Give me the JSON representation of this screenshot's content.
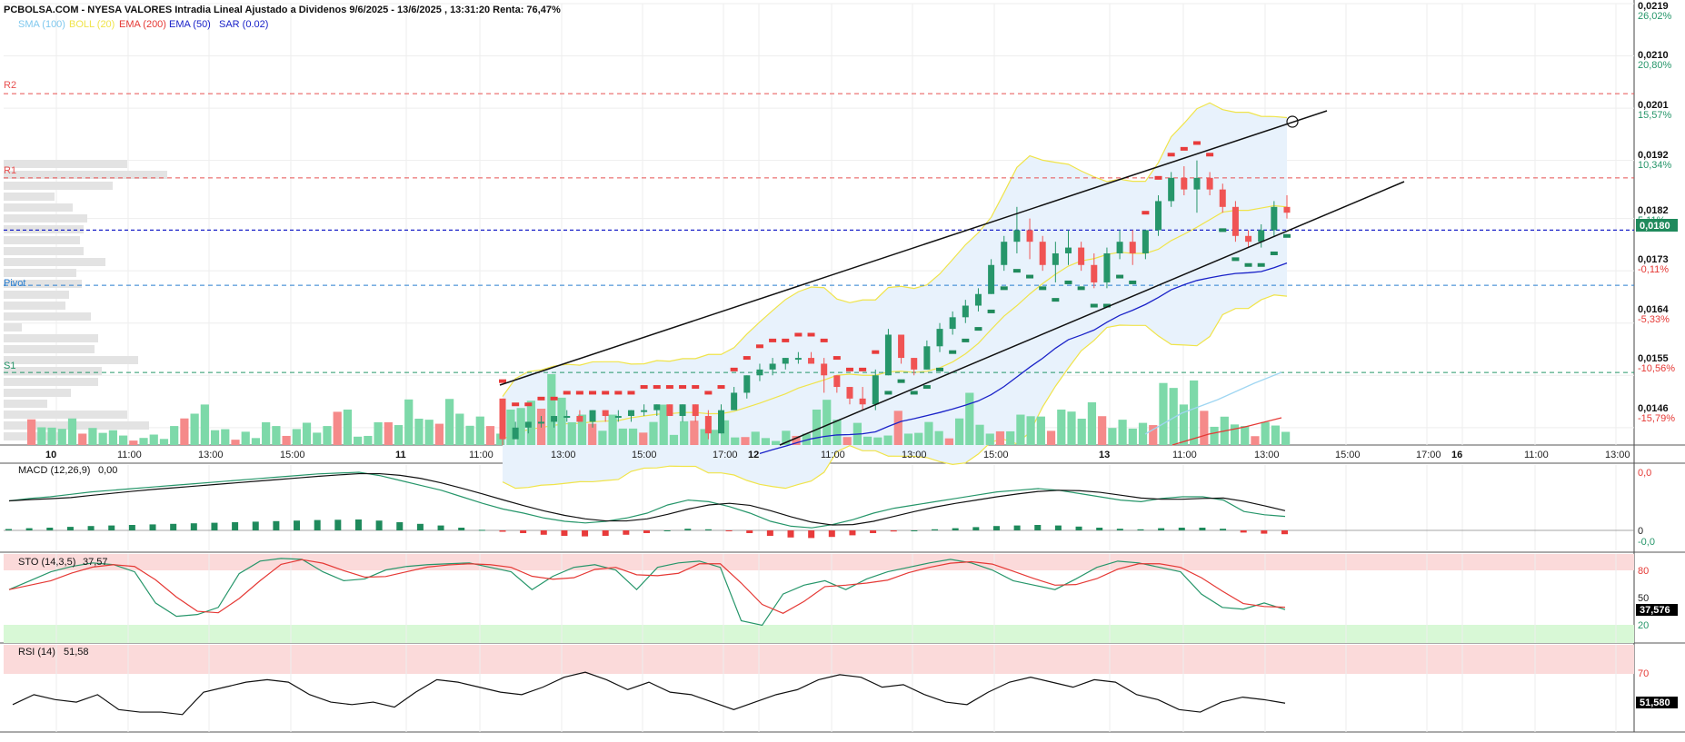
{
  "header": {
    "title": "PCBOLSA.COM - NYESA VALORES Intradia Lineal Ajustado a Dividenos 9/6/2025 - 13/6/2025 , 13:31:20 Renta: 76,47%",
    "indicators": [
      {
        "label": "SMA (100)",
        "color": "#7fc8ee"
      },
      {
        "label": "BOLL (20)",
        "color": "#f0e44a"
      },
      {
        "label": "EMA (200)",
        "color": "#e53935"
      },
      {
        "label": "EMA (50)",
        "color": "#1a22c8"
      },
      {
        "label": "SAR (0.02)",
        "color": "#1a22c8"
      }
    ]
  },
  "colors": {
    "up": "#26966a",
    "down": "#f05454",
    "vol_up": "#7dd9a9",
    "vol_down": "#f58a8a",
    "sar_up": "#1f8a5c",
    "sar_down": "#e83b3b"
  },
  "price_axis": {
    "ticks": [
      "0,0219",
      "0,0210",
      "0,0201",
      "0,0192",
      "0,0182",
      "0,0173",
      "0,0164",
      "0,0155",
      "0,0146"
    ],
    "pcts": [
      "26,02%",
      "20,80%",
      "15,57%",
      "10,34%",
      "5,11%",
      "-0,11%",
      "-5,33%",
      "-10,56%",
      "-15,79%"
    ],
    "current": "0,0180"
  },
  "levels": {
    "R2": "R2",
    "R1": "R1",
    "Pivot": "Pivot",
    "S1": "S1"
  },
  "time_axis": {
    "days": [
      "10",
      "11",
      "12",
      "13",
      "16"
    ],
    "hours": [
      "11:00",
      "13:00",
      "15:00",
      "11:00",
      "13:00",
      "15:00",
      "17:00",
      "11:00",
      "13:00",
      "15:00",
      "11:00",
      "13:00",
      "15:00",
      "17:00",
      "11:00",
      "13:00"
    ]
  },
  "macd": {
    "label": "MACD (12,26,9)",
    "value": "0,00",
    "ticks": [
      "0,0",
      "0",
      "-0,0"
    ]
  },
  "sto": {
    "label": "STO (14,3,5)",
    "value": "37,57",
    "ticks": [
      "80",
      "50",
      "20"
    ],
    "current": "37,576"
  },
  "rsi": {
    "label": "RSI (14)",
    "value": "51,58",
    "ticks": [
      "70"
    ],
    "current": "51,580"
  },
  "chart_data": {
    "type": "candlestick",
    "title": "PCBOLSA.COM - NYESA VALORES Intradia Lineal Ajustado a Dividenos 9/6/2025 - 13/6/2025 , 13:31:20 Renta: 76,47%",
    "ylim": [
      0.0143,
      0.0219
    ],
    "candles": [
      {
        "o": 0.0151,
        "h": 0.0151,
        "l": 0.0143,
        "c": 0.0144
      },
      {
        "o": 0.0144,
        "h": 0.0147,
        "l": 0.0144,
        "c": 0.0146
      },
      {
        "o": 0.0146,
        "h": 0.0147,
        "l": 0.0145,
        "c": 0.0147
      },
      {
        "o": 0.0147,
        "h": 0.0148,
        "l": 0.0146,
        "c": 0.0147
      },
      {
        "o": 0.0147,
        "h": 0.0148,
        "l": 0.0146,
        "c": 0.0148
      },
      {
        "o": 0.0148,
        "h": 0.0149,
        "l": 0.0147,
        "c": 0.0148
      },
      {
        "o": 0.0148,
        "h": 0.0149,
        "l": 0.0147,
        "c": 0.0147
      },
      {
        "o": 0.0147,
        "h": 0.0149,
        "l": 0.0146,
        "c": 0.0149
      },
      {
        "o": 0.0149,
        "h": 0.0149,
        "l": 0.0147,
        "c": 0.0148
      },
      {
        "o": 0.0148,
        "h": 0.0149,
        "l": 0.0147,
        "c": 0.0148
      },
      {
        "o": 0.0148,
        "h": 0.0149,
        "l": 0.0147,
        "c": 0.0149
      },
      {
        "o": 0.0149,
        "h": 0.015,
        "l": 0.0148,
        "c": 0.0149
      },
      {
        "o": 0.0149,
        "h": 0.015,
        "l": 0.0148,
        "c": 0.015
      },
      {
        "o": 0.015,
        "h": 0.015,
        "l": 0.0148,
        "c": 0.0148
      },
      {
        "o": 0.0148,
        "h": 0.015,
        "l": 0.0147,
        "c": 0.015
      },
      {
        "o": 0.015,
        "h": 0.015,
        "l": 0.0147,
        "c": 0.0148
      },
      {
        "o": 0.0148,
        "h": 0.0149,
        "l": 0.0144,
        "c": 0.0145
      },
      {
        "o": 0.0145,
        "h": 0.015,
        "l": 0.0145,
        "c": 0.0149
      },
      {
        "o": 0.0149,
        "h": 0.0153,
        "l": 0.0149,
        "c": 0.0152
      },
      {
        "o": 0.0152,
        "h": 0.0155,
        "l": 0.0151,
        "c": 0.0155
      },
      {
        "o": 0.0155,
        "h": 0.0157,
        "l": 0.0154,
        "c": 0.0156
      },
      {
        "o": 0.0156,
        "h": 0.0158,
        "l": 0.0155,
        "c": 0.0157
      },
      {
        "o": 0.0157,
        "h": 0.0158,
        "l": 0.0156,
        "c": 0.0158
      },
      {
        "o": 0.0158,
        "h": 0.0159,
        "l": 0.0157,
        "c": 0.0158
      },
      {
        "o": 0.0158,
        "h": 0.0159,
        "l": 0.0157,
        "c": 0.0157
      },
      {
        "o": 0.0157,
        "h": 0.0158,
        "l": 0.0152,
        "c": 0.0155
      },
      {
        "o": 0.0155,
        "h": 0.0155,
        "l": 0.0152,
        "c": 0.0153
      },
      {
        "o": 0.0153,
        "h": 0.0153,
        "l": 0.015,
        "c": 0.0151
      },
      {
        "o": 0.0151,
        "h": 0.0153,
        "l": 0.0149,
        "c": 0.015
      },
      {
        "o": 0.015,
        "h": 0.0156,
        "l": 0.0149,
        "c": 0.0155
      },
      {
        "o": 0.0155,
        "h": 0.0163,
        "l": 0.0155,
        "c": 0.0162
      },
      {
        "o": 0.0162,
        "h": 0.0162,
        "l": 0.0157,
        "c": 0.0158
      },
      {
        "o": 0.0158,
        "h": 0.0158,
        "l": 0.0155,
        "c": 0.0156
      },
      {
        "o": 0.0156,
        "h": 0.0161,
        "l": 0.0156,
        "c": 0.016
      },
      {
        "o": 0.016,
        "h": 0.0164,
        "l": 0.0159,
        "c": 0.0163
      },
      {
        "o": 0.0163,
        "h": 0.0166,
        "l": 0.0162,
        "c": 0.0165
      },
      {
        "o": 0.0165,
        "h": 0.0168,
        "l": 0.0164,
        "c": 0.0167
      },
      {
        "o": 0.0167,
        "h": 0.017,
        "l": 0.0166,
        "c": 0.0169
      },
      {
        "o": 0.0169,
        "h": 0.0175,
        "l": 0.0169,
        "c": 0.0174
      },
      {
        "o": 0.0174,
        "h": 0.0179,
        "l": 0.0173,
        "c": 0.0178
      },
      {
        "o": 0.0178,
        "h": 0.0184,
        "l": 0.0176,
        "c": 0.018
      },
      {
        "o": 0.018,
        "h": 0.0182,
        "l": 0.0175,
        "c": 0.0178
      },
      {
        "o": 0.0178,
        "h": 0.0179,
        "l": 0.0173,
        "c": 0.0174
      },
      {
        "o": 0.0174,
        "h": 0.0178,
        "l": 0.0171,
        "c": 0.0176
      },
      {
        "o": 0.0176,
        "h": 0.018,
        "l": 0.0174,
        "c": 0.0177
      },
      {
        "o": 0.0177,
        "h": 0.0178,
        "l": 0.0173,
        "c": 0.0174
      },
      {
        "o": 0.0174,
        "h": 0.0176,
        "l": 0.017,
        "c": 0.0171
      },
      {
        "o": 0.0171,
        "h": 0.0177,
        "l": 0.017,
        "c": 0.0176
      },
      {
        "o": 0.0176,
        "h": 0.018,
        "l": 0.0175,
        "c": 0.0178
      },
      {
        "o": 0.0178,
        "h": 0.018,
        "l": 0.0174,
        "c": 0.0176
      },
      {
        "o": 0.0176,
        "h": 0.018,
        "l": 0.0175,
        "c": 0.018
      },
      {
        "o": 0.018,
        "h": 0.0186,
        "l": 0.0179,
        "c": 0.0185
      },
      {
        "o": 0.0185,
        "h": 0.019,
        "l": 0.0184,
        "c": 0.0189
      },
      {
        "o": 0.0189,
        "h": 0.0191,
        "l": 0.0186,
        "c": 0.0187
      },
      {
        "o": 0.0187,
        "h": 0.0192,
        "l": 0.0183,
        "c": 0.0189
      },
      {
        "o": 0.0189,
        "h": 0.019,
        "l": 0.0186,
        "c": 0.0187
      },
      {
        "o": 0.0187,
        "h": 0.0188,
        "l": 0.0183,
        "c": 0.0184
      },
      {
        "o": 0.0184,
        "h": 0.0185,
        "l": 0.0178,
        "c": 0.0179
      },
      {
        "o": 0.0179,
        "h": 0.018,
        "l": 0.0177,
        "c": 0.0178
      },
      {
        "o": 0.0178,
        "h": 0.0181,
        "l": 0.0177,
        "c": 0.018
      },
      {
        "o": 0.018,
        "h": 0.0185,
        "l": 0.0179,
        "c": 0.0184
      },
      {
        "o": 0.0184,
        "h": 0.0186,
        "l": 0.0182,
        "c": 0.0183
      }
    ],
    "volume": [
      58,
      20,
      25,
      32,
      28,
      15,
      30,
      12,
      18,
      15,
      10,
      8,
      15,
      12,
      20,
      35,
      55,
      40,
      18,
      25,
      12,
      15,
      10,
      45,
      20,
      12,
      28,
      22,
      15,
      30,
      75,
      40,
      12,
      18,
      24,
      30,
      35,
      45,
      32,
      40,
      48,
      52,
      45,
      38,
      30,
      25,
      20,
      35,
      45,
      70,
      82,
      80,
      68,
      45,
      32,
      28,
      25,
      30,
      20,
      26,
      28,
      26
    ],
    "macd": [
      0.5,
      0.8,
      1.0,
      1.3,
      1.6,
      1.8,
      2.0,
      2.2,
      2.4,
      2.6,
      2.8,
      3.0,
      3.2,
      3.4,
      3.6,
      3.8,
      3.9,
      4.0,
      3.6,
      3.0,
      2.4,
      1.8,
      1.0,
      0.2,
      -0.5,
      -1.0,
      -1.6,
      -2.0,
      -2.2,
      -2.0,
      -1.6,
      -1.0,
      0.0,
      0.6,
      0.4,
      -0.2,
      -1.0,
      -2.0,
      -2.6,
      -2.8,
      -2.4,
      -1.8,
      -1.0,
      -0.4,
      0.0,
      0.4,
      0.8,
      1.2,
      1.6,
      1.8,
      2.0,
      1.8,
      1.4,
      1.0,
      0.6,
      0.4,
      0.8,
      1.0,
      1.0,
      0.6,
      -0.8,
      -1.2,
      -1.4
    ],
    "sto": [
      60,
      70,
      80,
      86,
      90,
      88,
      80,
      45,
      30,
      32,
      40,
      78,
      92,
      95,
      94,
      80,
      70,
      72,
      82,
      86,
      88,
      89,
      90,
      85,
      80,
      60,
      75,
      85,
      88,
      82,
      60,
      85,
      90,
      92,
      85,
      25,
      20,
      55,
      65,
      70,
      60,
      72,
      80,
      85,
      90,
      94,
      90,
      82,
      70,
      65,
      60,
      72,
      85,
      92,
      90,
      85,
      80,
      55,
      40,
      38,
      45,
      37.57
    ],
    "rsi": [
      51,
      55,
      53,
      52,
      55,
      49,
      48,
      48,
      47,
      56,
      58,
      60,
      61,
      60,
      55,
      52,
      51,
      52,
      50,
      56,
      61,
      60,
      58,
      56,
      55,
      58,
      62,
      64,
      61,
      57,
      60,
      56,
      55,
      52,
      49,
      52,
      55,
      57,
      61,
      63,
      62,
      58,
      59,
      55,
      52,
      51,
      56,
      60,
      62,
      60,
      58,
      61,
      60,
      55,
      53,
      49,
      48,
      52,
      54,
      53,
      51.58
    ],
    "lines": {
      "R2": 0.02035,
      "R1": 0.0189,
      "current": 0.018,
      "Pivot": 0.01705,
      "S1": 0.01555
    }
  }
}
